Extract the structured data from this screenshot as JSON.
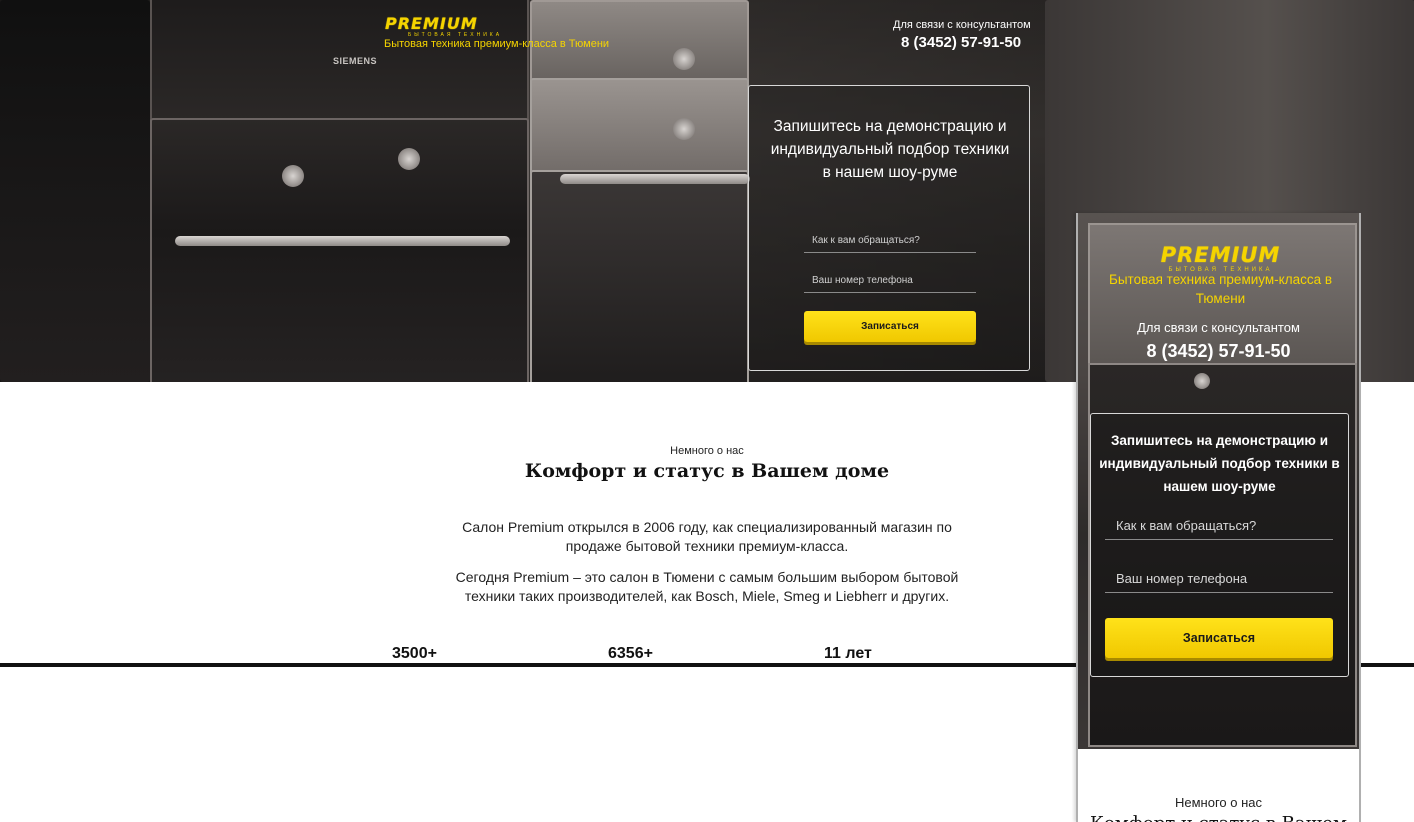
{
  "brand": {
    "logo_word": "PREMIUM",
    "logo_sub": "БЫТОВАЯ ТЕХНИКА",
    "tagline": "Бытовая техника премиум-класса в Тюмени",
    "accent_color": "#f5d400"
  },
  "contact": {
    "label": "Для связи с консультантом",
    "phone": "8 (3452) 57-91-50"
  },
  "hero_image": {
    "brand_on_oven": "SIEMENS"
  },
  "signup_form": {
    "title": "Запишитесь на демонстрацию и индивидуальный подбор техники в нашем шоу-руме",
    "name_placeholder": "Как к вам обращаться?",
    "phone_placeholder": "Ваш номер телефона",
    "submit_label": "Записаться",
    "button_color": "#f5d400"
  },
  "about": {
    "eyebrow": "Немного о нас",
    "title": "Комфорт и статус в Вашем доме",
    "paragraphs": [
      "Салон Premium открылся в 2006 году, как специализированный магазин по продаже бытовой техники премиум-класса.",
      "Сегодня Premium – это салон в Тюмени с самым большим выбором бытовой техники таких производителей, как Bosch, Miele, Smeg и Liebherr и других."
    ],
    "stats": [
      "3500+",
      "6356+",
      "11 лет"
    ]
  }
}
